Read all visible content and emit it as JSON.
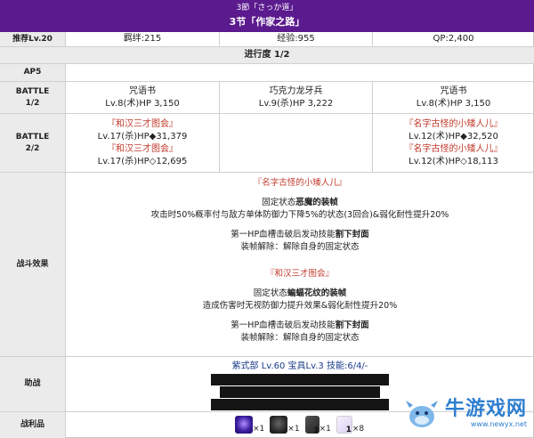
{
  "header": {
    "subtitle": "3節「さっか道」",
    "title": "3节「作家之路」"
  },
  "info": {
    "level_label": "推荐Lv.20",
    "bond": "羁绊:215",
    "exp": "经验:955",
    "qp": "QP:2,400"
  },
  "progress": "进行度 1/2",
  "ap": "AP5",
  "battle1": {
    "label_1": "BATTLE",
    "label_2": "1/2",
    "enemies": [
      {
        "name": "咒语书",
        "stats": "Lv.8(术)HP 3,150"
      },
      {
        "name": "巧克力龙牙兵",
        "stats": "Lv.9(杀)HP 3,222"
      },
      {
        "name": "咒语书",
        "stats": "Lv.8(术)HP 3,150"
      }
    ]
  },
  "battle2": {
    "label_1": "BATTLE",
    "label_2": "2/2",
    "left": {
      "name_1": "『和汉三才图会』",
      "stats_1": "Lv.17(杀)HP◆31,379",
      "name_2": "『和汉三才图会』",
      "stats_2": "Lv.17(杀)HP◇12,695"
    },
    "right": {
      "name_1": "『名字古怪的小矮人儿』",
      "stats_1": "Lv.12(术)HP◆32,520",
      "name_2": "『名字古怪的小矮人儿』",
      "stats_2": "Lv.12(术)HP◇18,113"
    }
  },
  "effects": {
    "label": "战斗效果",
    "block1": {
      "title": "『名字古怪的小矮人儿』",
      "line1_prefix": "固定状态",
      "line1_bold": "恶魔的装帧",
      "line2": "攻击时50%概率付与敌方单体防御力下降5%的状态(3回合)&弱化耐性提升20%",
      "line3_prefix": "第一HP血槽击破后发动技能",
      "line3_bold": "割下封面",
      "line4": "装帧解除：解除自身的固定状态"
    },
    "block2": {
      "title": "『和汉三才图会』",
      "line1_prefix": "固定状态",
      "line1_bold": "蝙蝠花纹的装帧",
      "line2": "造成伤害时无视防御力提升效果&弱化耐性提升20%",
      "line3_prefix": "第一HP血槽击破后发动技能",
      "line3_bold": "割下封面",
      "line4": "装帧解除：解除自身的固定状态"
    }
  },
  "support": {
    "label": "助战",
    "text": "紫式部 Lv.60 宝具Lv.3 技能:6/4/-"
  },
  "loot": {
    "label": "战利品",
    "items": [
      {
        "icon": "purple-gem-icon",
        "count": "×1"
      },
      {
        "icon": "dark-orb-icon",
        "count": "×1"
      },
      {
        "icon": "dark-bar-icon",
        "badge": "1",
        "count": "×1"
      },
      {
        "icon": "scroll-icon",
        "badge": "1",
        "count": "×8"
      }
    ]
  },
  "watermark": {
    "text": "牛游戏网",
    "url": "www.newyx.net"
  },
  "colors": {
    "header": "#5b1a8e",
    "enemy_name": "#c0392b",
    "label_bg": "#ebebeb",
    "watermark": "#2f7fd0"
  }
}
